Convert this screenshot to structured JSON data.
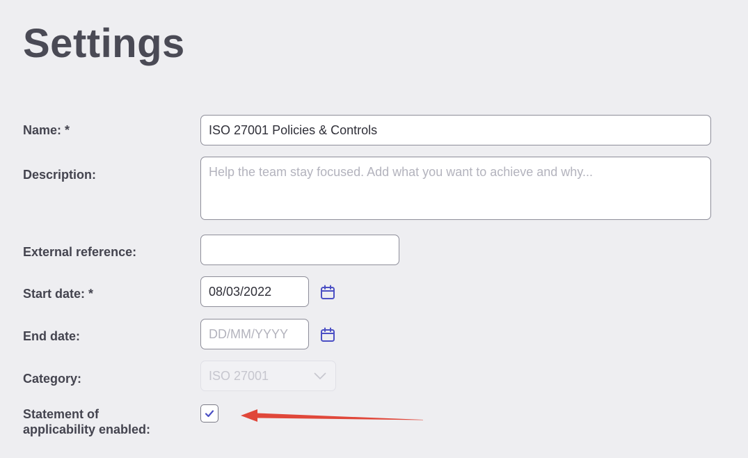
{
  "page": {
    "title": "Settings"
  },
  "form": {
    "name": {
      "label": "Name: *",
      "value": "ISO 27001 Policies & Controls"
    },
    "description": {
      "label": "Description:",
      "value": "",
      "placeholder": "Help the team stay focused. Add what you want to achieve and why..."
    },
    "external_reference": {
      "label": "External reference:",
      "value": ""
    },
    "start_date": {
      "label": "Start date: *",
      "value": "08/03/2022",
      "icon": "calendar-icon"
    },
    "end_date": {
      "label": "End date:",
      "value": "",
      "placeholder": "DD/MM/YYYY",
      "icon": "calendar-icon"
    },
    "category": {
      "label": "Category:",
      "selected": "ISO 27001",
      "disabled": true,
      "icon": "chevron-down-icon"
    },
    "soa": {
      "label_line1": "Statement of",
      "label_line2": "applicability enabled:",
      "checked": true,
      "icon": "checkmark-icon"
    }
  },
  "annotation": {
    "icon": "arrow-left-icon",
    "color": "#e0473a"
  },
  "colors": {
    "background": "#eeeef1",
    "accent": "#4b4fc4",
    "text": "#44444f"
  }
}
